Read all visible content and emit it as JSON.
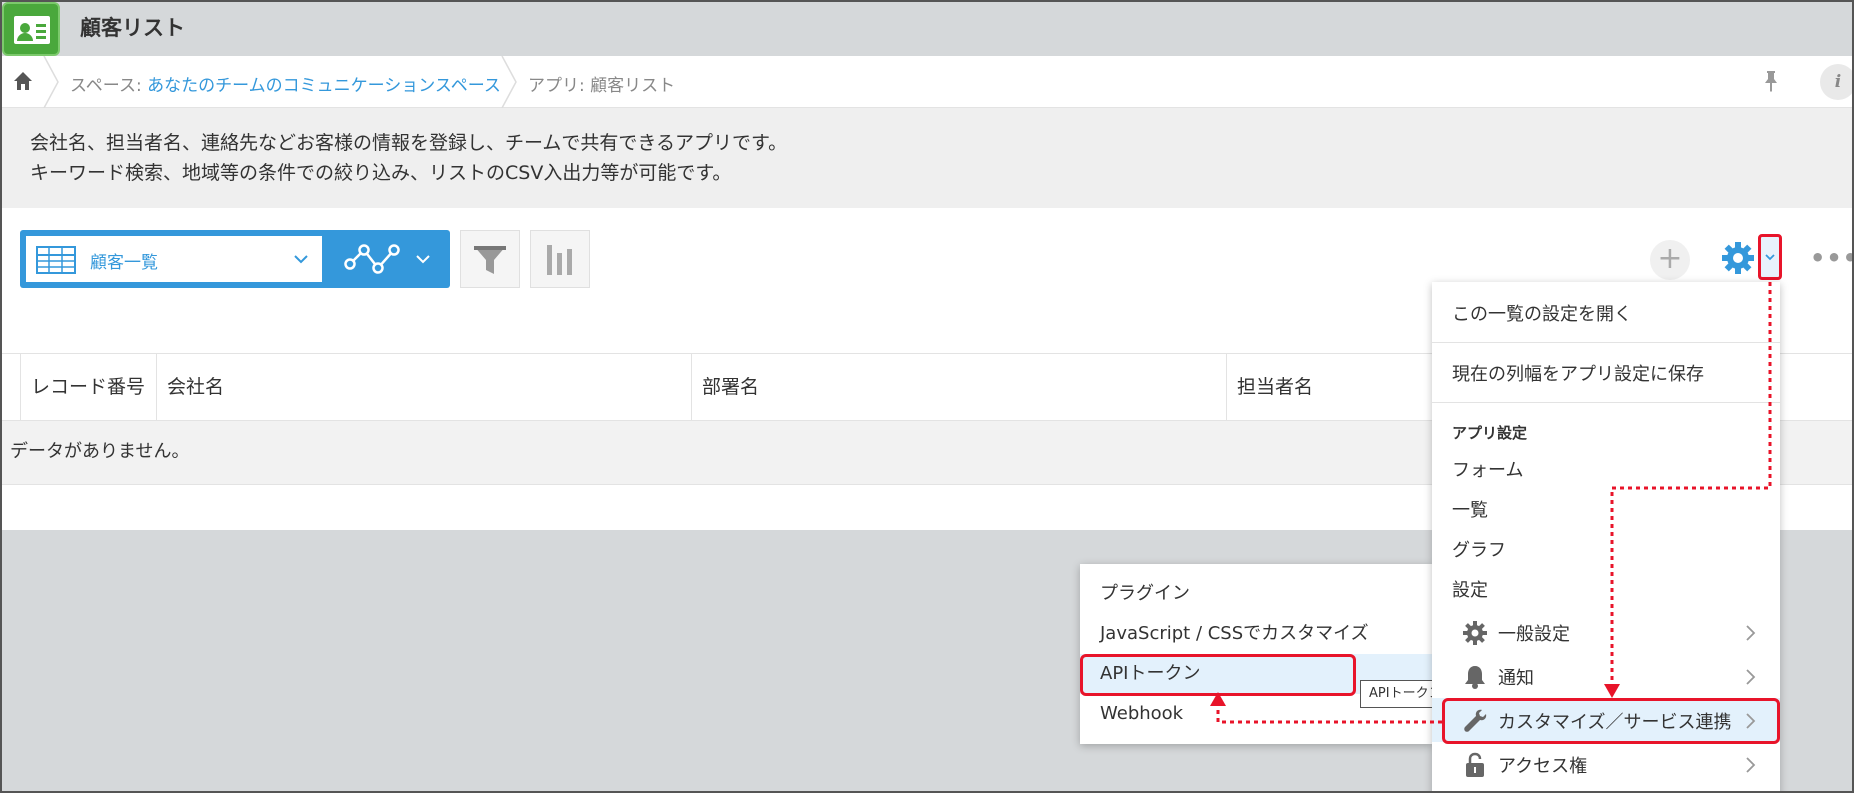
{
  "app": {
    "title": "顧客リスト"
  },
  "breadcrumb": {
    "space_prefix": "スペース: ",
    "space_name": "あなたのチームのコミュニケーションスペース",
    "app_label": "アプリ: 顧客リスト"
  },
  "description": {
    "line1": "会社名、担当者名、連絡先などお客様の情報を登録し、チームで共有できるアプリです。",
    "line2": "キーワード検索、地域等の条件での絞り込み、リストのCSV入出力等が可能です。"
  },
  "toolbar": {
    "view_name": "顧客一覧",
    "plus": "+",
    "more": "•••"
  },
  "table": {
    "columns": [
      "レコード番号",
      "会社名",
      "部署名",
      "担当者名"
    ],
    "empty_message": "データがありません。"
  },
  "menu": {
    "open_view_settings": "この一覧の設定を開く",
    "save_column_width": "現在の列幅をアプリ設定に保存",
    "section_app_settings": "アプリ設定",
    "form": "フォーム",
    "view": "一覧",
    "graph": "グラフ",
    "settings": "設定",
    "general": "一般設定",
    "notification": "通知",
    "customize": "カスタマイズ／サービス連携",
    "access": "アクセス権"
  },
  "submenu": {
    "plugin": "プラグイン",
    "js_css": "JavaScript / CSSでカスタマイズ",
    "api_token": "APIトークン",
    "webhook": "Webhook"
  },
  "tooltip": {
    "text": "APIトークン"
  },
  "colors": {
    "accent": "#3498db",
    "highlight": "#e8142a",
    "app_green": "#4aa83c"
  }
}
